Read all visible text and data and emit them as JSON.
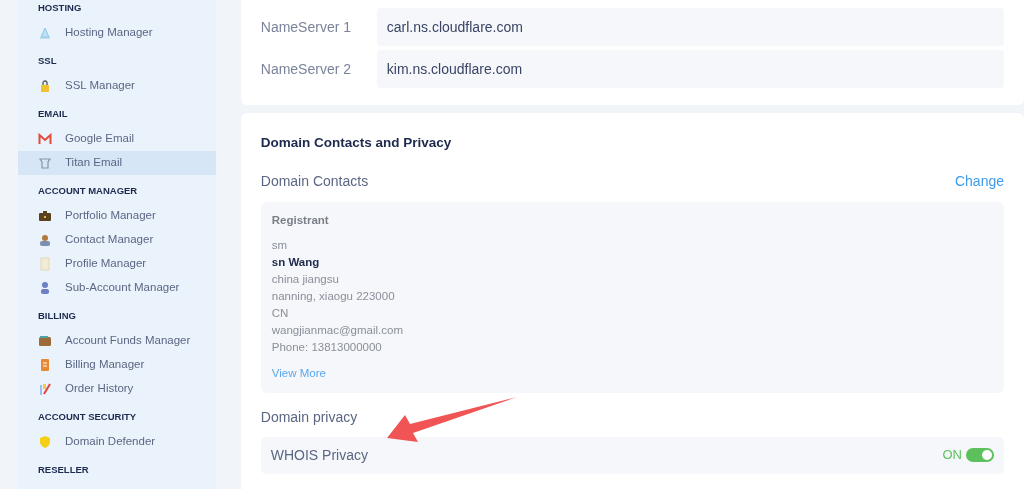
{
  "sidebar": {
    "sections": [
      {
        "title": "HOSTING",
        "items": [
          {
            "label": "Hosting Manager",
            "selected": false
          }
        ]
      },
      {
        "title": "SSL",
        "items": [
          {
            "label": "SSL Manager",
            "selected": false
          }
        ]
      },
      {
        "title": "EMAIL",
        "items": [
          {
            "label": "Google Email",
            "selected": false
          },
          {
            "label": "Titan Email",
            "selected": true
          }
        ]
      },
      {
        "title": "ACCOUNT MANAGER",
        "items": [
          {
            "label": "Portfolio Manager",
            "selected": false
          },
          {
            "label": "Contact Manager",
            "selected": false
          },
          {
            "label": "Profile Manager",
            "selected": false
          },
          {
            "label": "Sub-Account Manager",
            "selected": false
          }
        ]
      },
      {
        "title": "BILLING",
        "items": [
          {
            "label": "Account Funds Manager",
            "selected": false
          },
          {
            "label": "Billing Manager",
            "selected": false
          },
          {
            "label": "Order History",
            "selected": false
          }
        ]
      },
      {
        "title": "ACCOUNT SECURITY",
        "items": [
          {
            "label": "Domain Defender",
            "selected": false
          }
        ]
      },
      {
        "title": "RESELLER"
      }
    ]
  },
  "nameservers": [
    {
      "label": "NameServer 1",
      "value": "carl.ns.cloudflare.com"
    },
    {
      "label": "NameServer 2",
      "value": "kim.ns.cloudflare.com"
    }
  ],
  "contacts_card": {
    "title": "Domain Contacts and Privacy",
    "contacts_label": "Domain Contacts",
    "change_link": "Change",
    "registrant": {
      "heading": "Registrant",
      "lines": [
        {
          "text": "sm",
          "kind": "plain"
        },
        {
          "text": "sn Wang",
          "kind": "name"
        },
        {
          "text": "china jiangsu",
          "kind": "plain"
        },
        {
          "text": "nanning, xiaogu 223000",
          "kind": "plain"
        },
        {
          "text": "CN",
          "kind": "plain"
        },
        {
          "text": "wangjianmac@gmail.com",
          "kind": "plain"
        },
        {
          "text": "Phone: 13813000000",
          "kind": "plain"
        }
      ],
      "view_more": "View More"
    },
    "privacy_label": "Domain privacy",
    "privacy": {
      "label": "WHOIS Privacy",
      "state_text": "ON",
      "on": true
    }
  },
  "annotations": [
    {
      "kind": "arrow"
    }
  ]
}
